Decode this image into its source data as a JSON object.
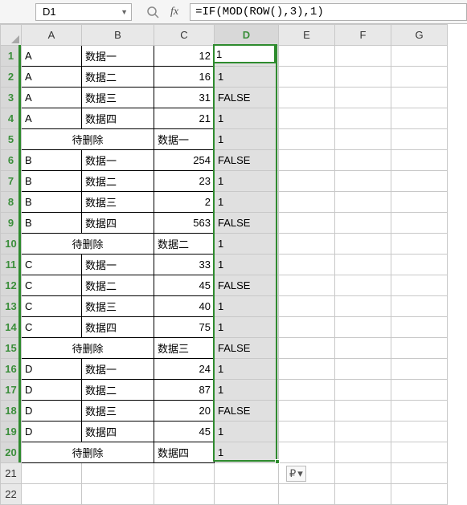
{
  "namebox": {
    "value": "D1"
  },
  "formula": "=IF(MOD(ROW(),3),1)",
  "columns": [
    "A",
    "B",
    "C",
    "D",
    "E",
    "F",
    "G"
  ],
  "col_widths": {
    "A": 75,
    "B": 90,
    "C": 75,
    "D": 80,
    "E": 70,
    "F": 70,
    "G": 70
  },
  "active_cell": {
    "col": "D",
    "row": 1
  },
  "selection": {
    "col": "D",
    "row_start": 1,
    "row_end": 20
  },
  "rows": [
    {
      "n": 1,
      "A": "A",
      "B": "数据一",
      "C": "12",
      "D": "1",
      "merge": false,
      "ctxt": false
    },
    {
      "n": 2,
      "A": "A",
      "B": "数据二",
      "C": "16",
      "D": "1",
      "merge": false,
      "ctxt": false
    },
    {
      "n": 3,
      "A": "A",
      "B": "数据三",
      "C": "31",
      "D": "FALSE",
      "merge": false,
      "ctxt": false
    },
    {
      "n": 4,
      "A": "A",
      "B": "数据四",
      "C": "21",
      "D": "1",
      "merge": false,
      "ctxt": false
    },
    {
      "n": 5,
      "A": "",
      "B": "待删除",
      "C": "数据一",
      "D": "1",
      "merge": true,
      "ctxt": true
    },
    {
      "n": 6,
      "A": "B",
      "B": "数据一",
      "C": "254",
      "D": "FALSE",
      "merge": false,
      "ctxt": false
    },
    {
      "n": 7,
      "A": "B",
      "B": "数据二",
      "C": "23",
      "D": "1",
      "merge": false,
      "ctxt": false
    },
    {
      "n": 8,
      "A": "B",
      "B": "数据三",
      "C": "2",
      "D": "1",
      "merge": false,
      "ctxt": false
    },
    {
      "n": 9,
      "A": "B",
      "B": "数据四",
      "C": "563",
      "D": "FALSE",
      "merge": false,
      "ctxt": false
    },
    {
      "n": 10,
      "A": "",
      "B": "待删除",
      "C": "数据二",
      "D": "1",
      "merge": true,
      "ctxt": true
    },
    {
      "n": 11,
      "A": "C",
      "B": "数据一",
      "C": "33",
      "D": "1",
      "merge": false,
      "ctxt": false
    },
    {
      "n": 12,
      "A": "C",
      "B": "数据二",
      "C": "45",
      "D": "FALSE",
      "merge": false,
      "ctxt": false
    },
    {
      "n": 13,
      "A": "C",
      "B": "数据三",
      "C": "40",
      "D": "1",
      "merge": false,
      "ctxt": false
    },
    {
      "n": 14,
      "A": "C",
      "B": "数据四",
      "C": "75",
      "D": "1",
      "merge": false,
      "ctxt": false
    },
    {
      "n": 15,
      "A": "",
      "B": "待删除",
      "C": "数据三",
      "D": "FALSE",
      "merge": true,
      "ctxt": true
    },
    {
      "n": 16,
      "A": "D",
      "B": "数据一",
      "C": "24",
      "D": "1",
      "merge": false,
      "ctxt": false
    },
    {
      "n": 17,
      "A": "D",
      "B": "数据二",
      "C": "87",
      "D": "1",
      "merge": false,
      "ctxt": false
    },
    {
      "n": 18,
      "A": "D",
      "B": "数据三",
      "C": "20",
      "D": "FALSE",
      "merge": false,
      "ctxt": false
    },
    {
      "n": 19,
      "A": "D",
      "B": "数据四",
      "C": "45",
      "D": "1",
      "merge": false,
      "ctxt": false
    },
    {
      "n": 20,
      "A": "",
      "B": "待删除",
      "C": "数据四",
      "D": "1",
      "merge": true,
      "ctxt": true
    },
    {
      "n": 21,
      "A": "",
      "B": "",
      "C": "",
      "D": "",
      "merge": false,
      "ctxt": false,
      "blank": true
    },
    {
      "n": 22,
      "A": "",
      "B": "",
      "C": "",
      "D": "",
      "merge": false,
      "ctxt": false,
      "blank": true
    }
  ],
  "smart_tag": {
    "glyph": "₽",
    "caret": "▾"
  }
}
